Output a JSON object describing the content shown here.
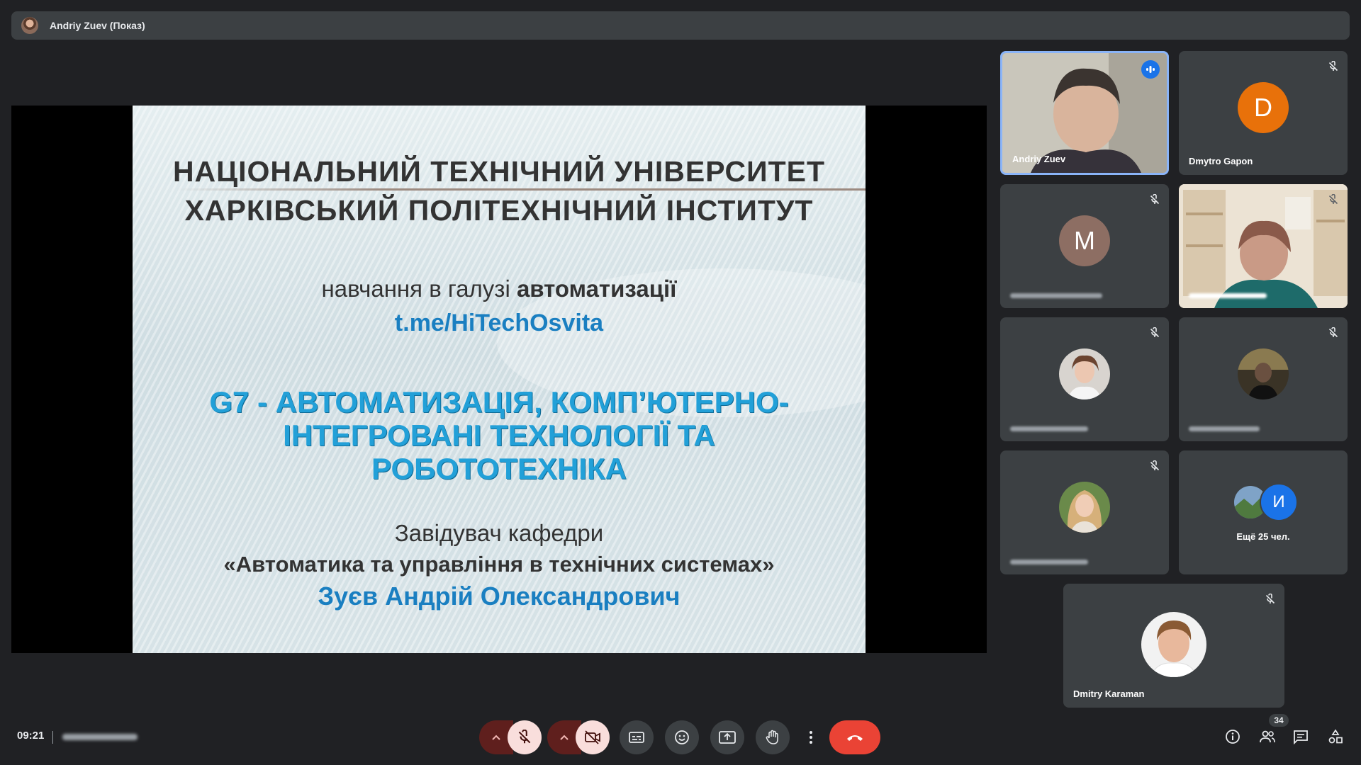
{
  "presenter_bar": {
    "title": "Andriy Zuev (Показ)"
  },
  "slide": {
    "university_line1": "НАЦІОНАЛЬНИЙ ТЕХНІЧНИЙ УНІВЕРСИТЕТ",
    "university_line2": "ХАРКІВСЬКИЙ ПОЛІТЕХНІЧНИЙ ІНСТИТУТ",
    "study_prefix": "навчання в галузі ",
    "study_bold": "автоматизації",
    "link": "t.me/HiTechOsvita",
    "program_line1": "G7 - АВТОМАТИЗАЦІЯ, КОМП’ЮТЕРНО-",
    "program_line2": "ІНТЕГРОВАНІ ТЕХНОЛОГІЇ ТА",
    "program_line3": "РОБОТОТЕХНІКА",
    "head_title": "Завідувач кафедри",
    "department": "«Автоматика та управління в технічних системах»",
    "person": "Зуєв Андрій Олександрович"
  },
  "participants": {
    "tile1_name": "Andriy Zuev",
    "tile2_name": "Dmytro Gapon",
    "tile2_initial": "D",
    "tile3_initial": "M",
    "more_initial": "И",
    "more_label": "Ещё 25 чел.",
    "featured_name": "Dmitry Karaman"
  },
  "bottom_bar": {
    "time": "09:21",
    "participants_count": "34"
  },
  "colors": {
    "background": "#202124",
    "tile": "#3c4043",
    "active_border": "#8ab4f8",
    "end_call": "#ea4335",
    "avatar_d": "#e8710a",
    "avatar_m": "#8d6e63",
    "avatar_i": "#1a73e8"
  }
}
